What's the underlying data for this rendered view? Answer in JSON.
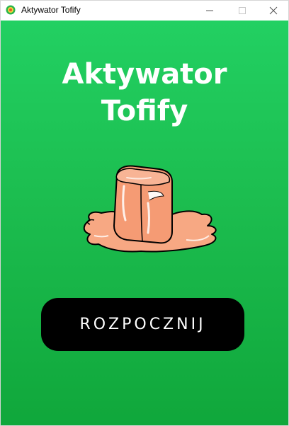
{
  "window": {
    "title": "Aktywator Tofify",
    "icon": "app-logo-icon",
    "controls": [
      "minimize-icon",
      "maximize-icon",
      "close-icon"
    ]
  },
  "main": {
    "heading_line1": "Aktywator",
    "heading_line2": "Tofify",
    "illustration": "melting-ice-cube-icon",
    "start_button_label": "ROZPOCZNIJ"
  },
  "colors": {
    "background_top": "#22d062",
    "background_bottom": "#10a73b",
    "heading_text": "#ffffff",
    "button_background": "#000000",
    "button_text": "#ffffff",
    "ice_cube": "#f7a883"
  }
}
